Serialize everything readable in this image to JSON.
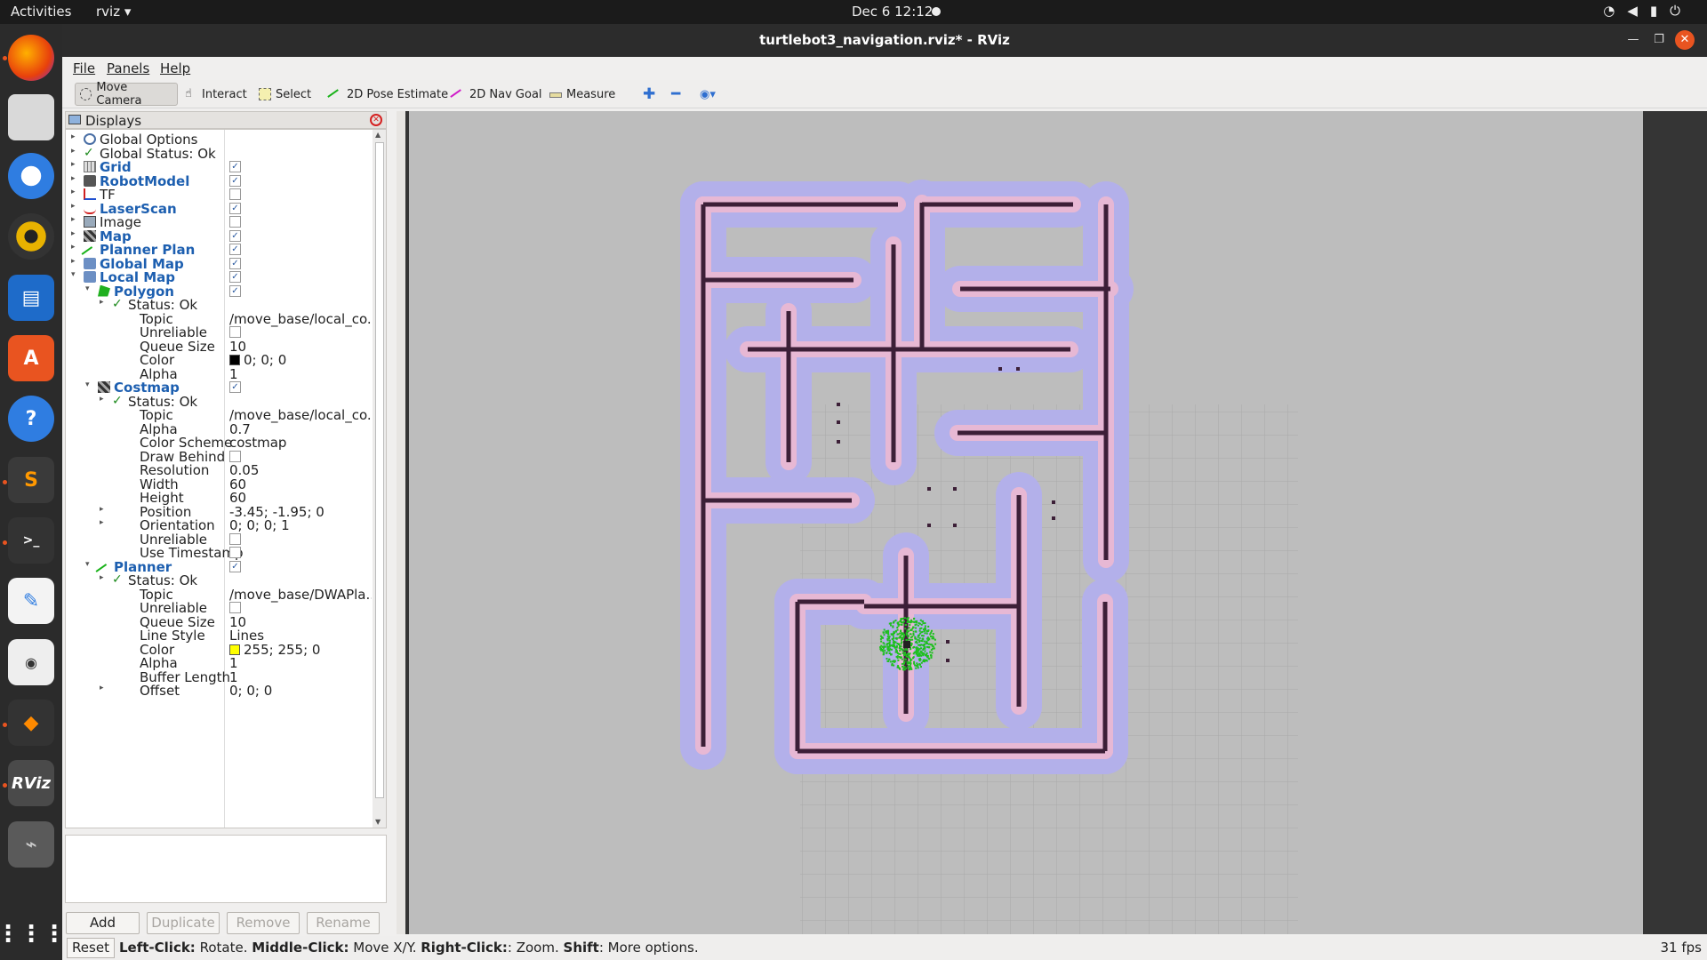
{
  "topbar": {
    "activities": "Activities",
    "app_menu": "rviz ▾",
    "clock": "Dec 6  12:12"
  },
  "window": {
    "title": "turtlebot3_navigation.rviz* - RViz"
  },
  "menu": [
    "File",
    "Panels",
    "Help"
  ],
  "toolbar": [
    {
      "label": "Move Camera",
      "icon": "move-camera-icon"
    },
    {
      "label": "Interact",
      "icon": "interact-icon"
    },
    {
      "label": "Select",
      "icon": "select-icon"
    },
    {
      "label": "2D Pose Estimate",
      "icon": "pose-estimate-icon"
    },
    {
      "label": "2D Nav Goal",
      "icon": "nav-goal-icon"
    },
    {
      "label": "Measure",
      "icon": "measure-icon"
    }
  ],
  "displays": {
    "title": "Displays",
    "rows": [
      {
        "depth": 0,
        "arrow": "▸",
        "name": "Global Options",
        "icon": "gear",
        "bold": false
      },
      {
        "depth": 0,
        "arrow": "▸",
        "name": "Global Status: Ok",
        "icon": "check",
        "bold": false
      },
      {
        "depth": 0,
        "arrow": "▸",
        "name": "Grid",
        "icon": "grid",
        "bold": true,
        "checked": true
      },
      {
        "depth": 0,
        "arrow": "▸",
        "name": "RobotModel",
        "icon": "robot",
        "bold": true,
        "checked": true
      },
      {
        "depth": 0,
        "arrow": "▸",
        "name": "TF",
        "icon": "tf",
        "bold": false,
        "checked": false
      },
      {
        "depth": 0,
        "arrow": "▸",
        "name": "LaserScan",
        "icon": "laser",
        "bold": true,
        "checked": true
      },
      {
        "depth": 0,
        "arrow": "▸",
        "name": "Image",
        "icon": "image",
        "bold": false,
        "checked": false
      },
      {
        "depth": 0,
        "arrow": "▸",
        "name": "Map",
        "icon": "map",
        "bold": true,
        "checked": true
      },
      {
        "depth": 0,
        "arrow": "▸",
        "name": "Planner Plan",
        "icon": "path",
        "bold": true,
        "checked": true
      },
      {
        "depth": 0,
        "arrow": "▸",
        "name": "Global Map",
        "icon": "folder",
        "bold": true,
        "checked": true
      },
      {
        "depth": 0,
        "arrow": "▾",
        "name": "Local Map",
        "icon": "folder",
        "bold": true,
        "checked": true
      },
      {
        "depth": 1,
        "arrow": "▾",
        "name": "Polygon",
        "icon": "polygon",
        "bold": true,
        "checked": true
      },
      {
        "depth": 2,
        "arrow": "▸",
        "name": "Status: Ok",
        "icon": "check",
        "bold": false
      },
      {
        "depth": 2,
        "name": "Topic",
        "value": "/move_base/local_co..."
      },
      {
        "depth": 2,
        "name": "Unreliable",
        "checked": false
      },
      {
        "depth": 2,
        "name": "Queue Size",
        "value": "10"
      },
      {
        "depth": 2,
        "name": "Color",
        "value": "0; 0; 0",
        "swatch": "#000000"
      },
      {
        "depth": 2,
        "name": "Alpha",
        "value": "1"
      },
      {
        "depth": 1,
        "arrow": "▾",
        "name": "Costmap",
        "icon": "map",
        "bold": true,
        "checked": true
      },
      {
        "depth": 2,
        "arrow": "▸",
        "name": "Status: Ok",
        "icon": "check",
        "bold": false
      },
      {
        "depth": 2,
        "name": "Topic",
        "value": "/move_base/local_co..."
      },
      {
        "depth": 2,
        "name": "Alpha",
        "value": "0.7"
      },
      {
        "depth": 2,
        "name": "Color Scheme",
        "value": "costmap"
      },
      {
        "depth": 2,
        "name": "Draw Behind",
        "checked": false
      },
      {
        "depth": 2,
        "name": "Resolution",
        "value": "0.05"
      },
      {
        "depth": 2,
        "name": "Width",
        "value": "60"
      },
      {
        "depth": 2,
        "name": "Height",
        "value": "60"
      },
      {
        "depth": 2,
        "arrow": "▸",
        "name": "Position",
        "value": "-3.45; -1.95; 0"
      },
      {
        "depth": 2,
        "arrow": "▸",
        "name": "Orientation",
        "value": "0; 0; 0; 1"
      },
      {
        "depth": 2,
        "name": "Unreliable",
        "checked": false
      },
      {
        "depth": 2,
        "name": "Use Timestamp",
        "checked": false
      },
      {
        "depth": 1,
        "arrow": "▾",
        "name": "Planner",
        "icon": "path",
        "bold": true,
        "checked": true
      },
      {
        "depth": 2,
        "arrow": "▸",
        "name": "Status: Ok",
        "icon": "check",
        "bold": false
      },
      {
        "depth": 2,
        "name": "Topic",
        "value": "/move_base/DWAPla..."
      },
      {
        "depth": 2,
        "name": "Unreliable",
        "checked": false
      },
      {
        "depth": 2,
        "name": "Queue Size",
        "value": "10"
      },
      {
        "depth": 2,
        "name": "Line Style",
        "value": "Lines"
      },
      {
        "depth": 2,
        "name": "Color",
        "value": "255; 255; 0",
        "swatch": "#ffff00"
      },
      {
        "depth": 2,
        "name": "Alpha",
        "value": "1"
      },
      {
        "depth": 2,
        "name": "Buffer Length",
        "value": "1"
      },
      {
        "depth": 2,
        "arrow": "▸",
        "name": "Offset",
        "value": "0; 0; 0"
      }
    ],
    "buttons": [
      {
        "label": "Add",
        "enabled": true
      },
      {
        "label": "Duplicate",
        "enabled": false
      },
      {
        "label": "Remove",
        "enabled": false
      },
      {
        "label": "Rename",
        "enabled": false
      }
    ]
  },
  "status": {
    "reset": "Reset",
    "left_click": "Left-Click:",
    "left_text": " Rotate. ",
    "middle_click": "Middle-Click:",
    "middle_text": " Move X/Y. ",
    "right_click": "Right-Click:",
    "right_text": ": Zoom. ",
    "shift": "Shift",
    "shift_text": ": More options.",
    "fps": "31 fps"
  },
  "colors": {
    "map_background": "#bdbdbd",
    "inflation": "#b3b0ea",
    "inflation_inner": "#e7b8d4",
    "wall": "#3c1f37",
    "particles": "#1fbf1f"
  }
}
